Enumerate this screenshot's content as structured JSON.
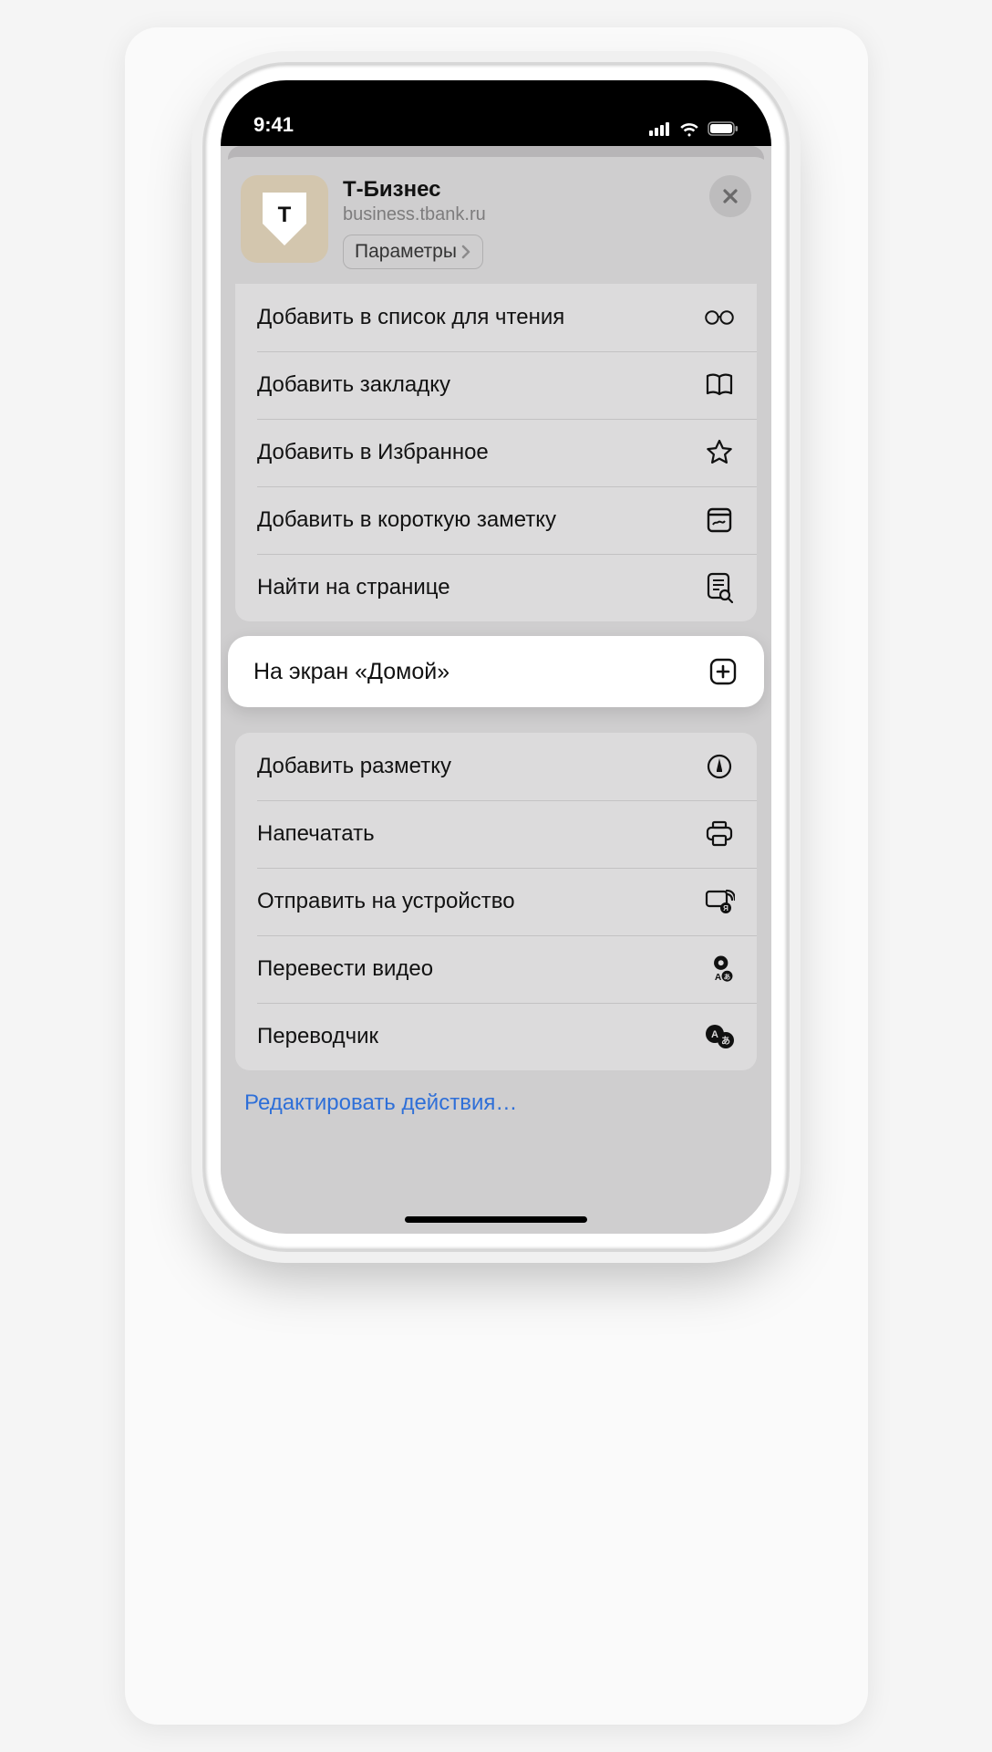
{
  "status": {
    "time": "9:41"
  },
  "header": {
    "title": "Т-Бизнес",
    "url": "business.tbank.ru",
    "params_label": "Параметры",
    "close": "×"
  },
  "group1": [
    {
      "label": "Добавить в список для чтения",
      "icon": "glasses-icon"
    },
    {
      "label": "Добавить закладку",
      "icon": "book-icon"
    },
    {
      "label": "Добавить в Избранное",
      "icon": "star-icon"
    },
    {
      "label": "Добавить в короткую заметку",
      "icon": "quicknote-icon"
    },
    {
      "label": "Найти на странице",
      "icon": "find-icon"
    }
  ],
  "highlight": {
    "label": "На экран «Домой»",
    "icon": "add-home-icon"
  },
  "group2": [
    {
      "label": "Добавить разметку",
      "icon": "markup-icon"
    },
    {
      "label": "Напечатать",
      "icon": "printer-icon"
    },
    {
      "label": "Отправить на устройство",
      "icon": "cast-icon"
    },
    {
      "label": "Перевести видео",
      "icon": "translate-video-icon"
    },
    {
      "label": "Переводчик",
      "icon": "translate-icon"
    }
  ],
  "edit_actions": "Редактировать действия…"
}
